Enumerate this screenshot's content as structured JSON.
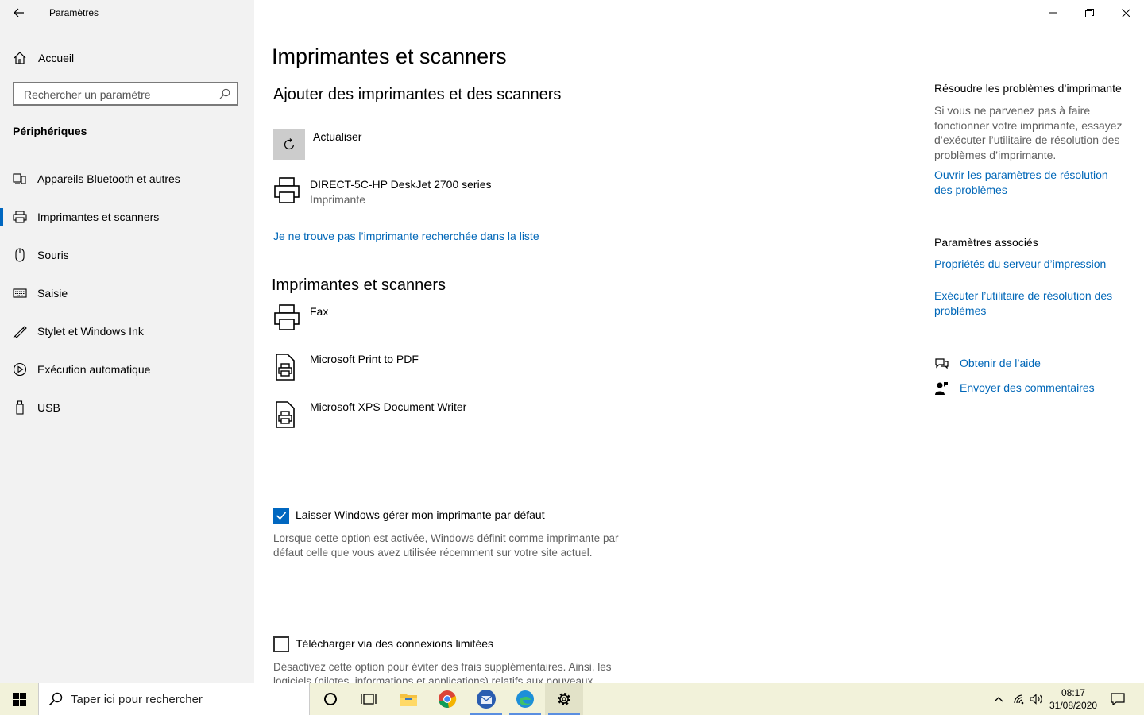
{
  "window": {
    "title": "Paramètres"
  },
  "sidebar": {
    "home_label": "Accueil",
    "search_placeholder": "Rechercher un paramètre",
    "category": "Périphériques",
    "items": [
      {
        "label": "Appareils Bluetooth et autres",
        "icon": "bluetooth-devices-icon"
      },
      {
        "label": "Imprimantes et scanners",
        "icon": "printer-icon",
        "selected": true
      },
      {
        "label": "Souris",
        "icon": "mouse-icon"
      },
      {
        "label": "Saisie",
        "icon": "keyboard-icon"
      },
      {
        "label": "Stylet et Windows Ink",
        "icon": "pen-icon"
      },
      {
        "label": "Exécution automatique",
        "icon": "autoplay-icon"
      },
      {
        "label": "USB",
        "icon": "usb-icon"
      }
    ]
  },
  "main": {
    "page_title": "Imprimantes et scanners",
    "add_section_title": "Ajouter des imprimantes et des scanners",
    "refresh_label": "Actualiser",
    "found_device": {
      "name": "DIRECT-5C-HP DeskJet 2700 series",
      "type": "Imprimante"
    },
    "not_listed_link": "Je ne trouve pas l’imprimante recherchée dans la liste",
    "list_section_title": "Imprimantes et scanners",
    "printers": [
      {
        "name": "Fax",
        "icon": "printer-icon"
      },
      {
        "name": "Microsoft Print to PDF",
        "icon": "document-printer-icon"
      },
      {
        "name": "Microsoft XPS Document Writer",
        "icon": "document-printer-icon"
      }
    ],
    "default_printer": {
      "label": "Laisser Windows gérer mon imprimante par défaut",
      "checked": true,
      "description": "Lorsque cette option est activée, Windows définit comme imprimante par défaut celle que vous avez utilisée récemment sur votre site actuel."
    },
    "metered": {
      "label": "Télécharger via des connexions limitées",
      "checked": false,
      "description": "Désactivez cette option pour éviter des frais supplémentaires. Ainsi, les logiciels (pilotes, informations et applications) relatifs aux nouveaux"
    }
  },
  "right_panel": {
    "troubleshoot_title": "Résoudre les problèmes d’imprimante",
    "troubleshoot_desc": "Si vous ne parvenez pas à faire fonctionner votre imprimante, essayez d’exécuter l’utilitaire de résolution des problèmes d’imprimante.",
    "troubleshoot_link": "Ouvrir les paramètres de résolution des problèmes",
    "related_title": "Paramètres associés",
    "related_links": [
      "Propriétés du serveur d’impression",
      "Exécuter l’utilitaire de résolution des problèmes"
    ],
    "help_link": "Obtenir de l’aide",
    "feedback_link": "Envoyer des commentaires"
  },
  "taskbar": {
    "search_placeholder": "Taper ici pour rechercher",
    "time": "08:17",
    "date": "31/08/2020"
  },
  "colors": {
    "accent": "#0067c0",
    "link": "#0067b8",
    "sidebar_bg": "#f2f2f2",
    "taskbar_bg": "#f2f2da"
  }
}
